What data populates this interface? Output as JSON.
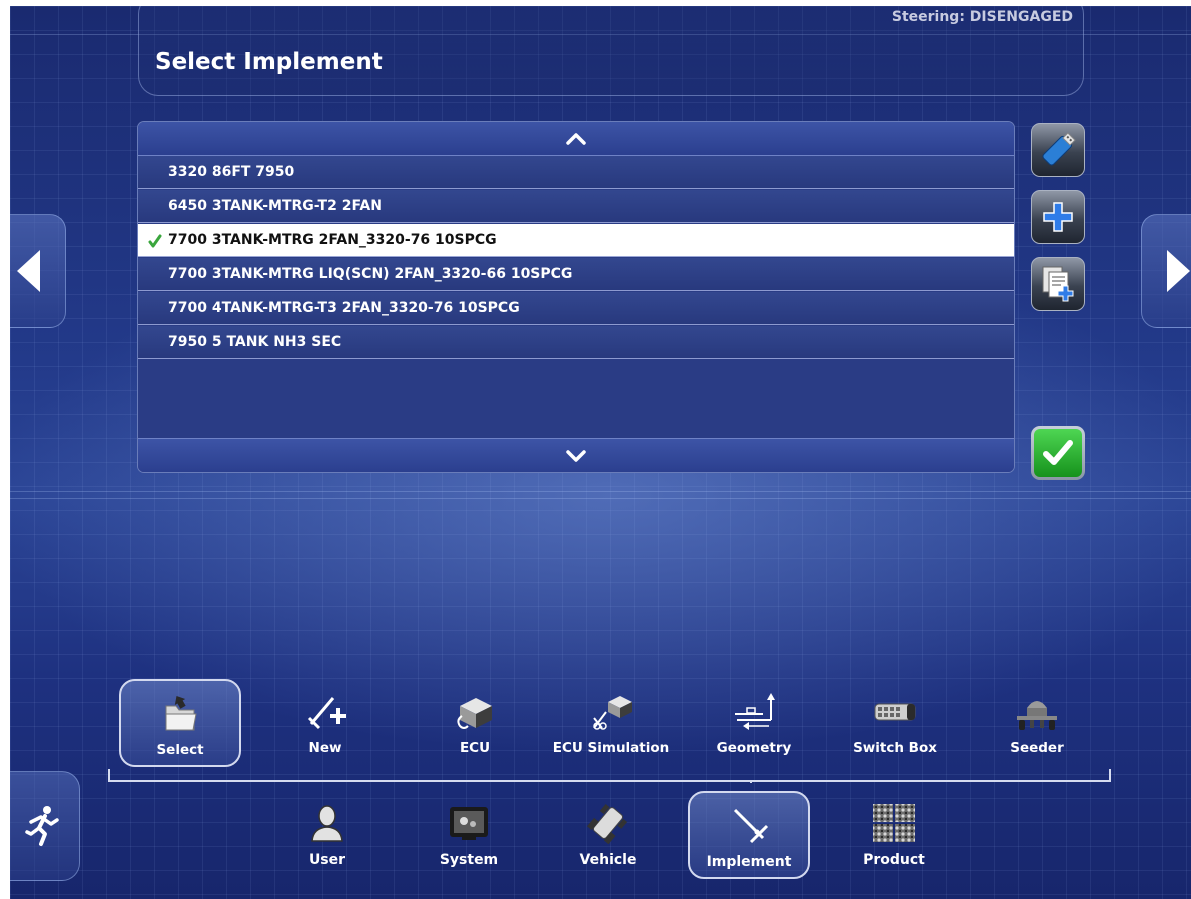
{
  "status": {
    "steering": "Steering: DISENGAGED"
  },
  "page": {
    "title": "Select Implement"
  },
  "implement_list": {
    "selected_index": 2,
    "items": [
      "3320 86FT 7950",
      "6450 3TANK-MTRG-T2 2FAN",
      "7700 3TANK-MTRG 2FAN_3320-76 10SPCG",
      "7700 3TANK-MTRG LIQ(SCN) 2FAN_3320-66 10SPCG",
      "7700 4TANK-MTRG-T3 2FAN_3320-76 10SPCG",
      "7950 5 TANK NH3 SEC"
    ]
  },
  "side_buttons": {
    "icons": [
      "usb-drive-icon",
      "plus-icon",
      "copy-document-icon"
    ],
    "confirm_icon": "checkmark-icon"
  },
  "sub_nav": {
    "items": [
      {
        "label": "Select",
        "icon": "select-folder-icon",
        "selected": true
      },
      {
        "label": "New",
        "icon": "new-implement-icon",
        "selected": false
      },
      {
        "label": "ECU",
        "icon": "ecu-icon",
        "selected": false
      },
      {
        "label": "ECU Simulation",
        "icon": "ecu-simulation-icon",
        "selected": false
      },
      {
        "label": "Geometry",
        "icon": "geometry-icon",
        "selected": false
      },
      {
        "label": "Switch Box",
        "icon": "switch-box-icon",
        "selected": false
      },
      {
        "label": "Seeder",
        "icon": "seeder-icon",
        "selected": false
      }
    ]
  },
  "main_nav": {
    "items": [
      {
        "label": "User",
        "icon": "user-icon",
        "selected": false
      },
      {
        "label": "System",
        "icon": "system-icon",
        "selected": false
      },
      {
        "label": "Vehicle",
        "icon": "vehicle-icon",
        "selected": false
      },
      {
        "label": "Implement",
        "icon": "implement-icon",
        "selected": true
      },
      {
        "label": "Product",
        "icon": "product-icon",
        "selected": false
      }
    ]
  },
  "colors": {
    "background": "#233a8a",
    "row": "#2f4289",
    "selected_row": "#ffffff",
    "confirm": "#2db833",
    "check": "#3aa63d"
  }
}
